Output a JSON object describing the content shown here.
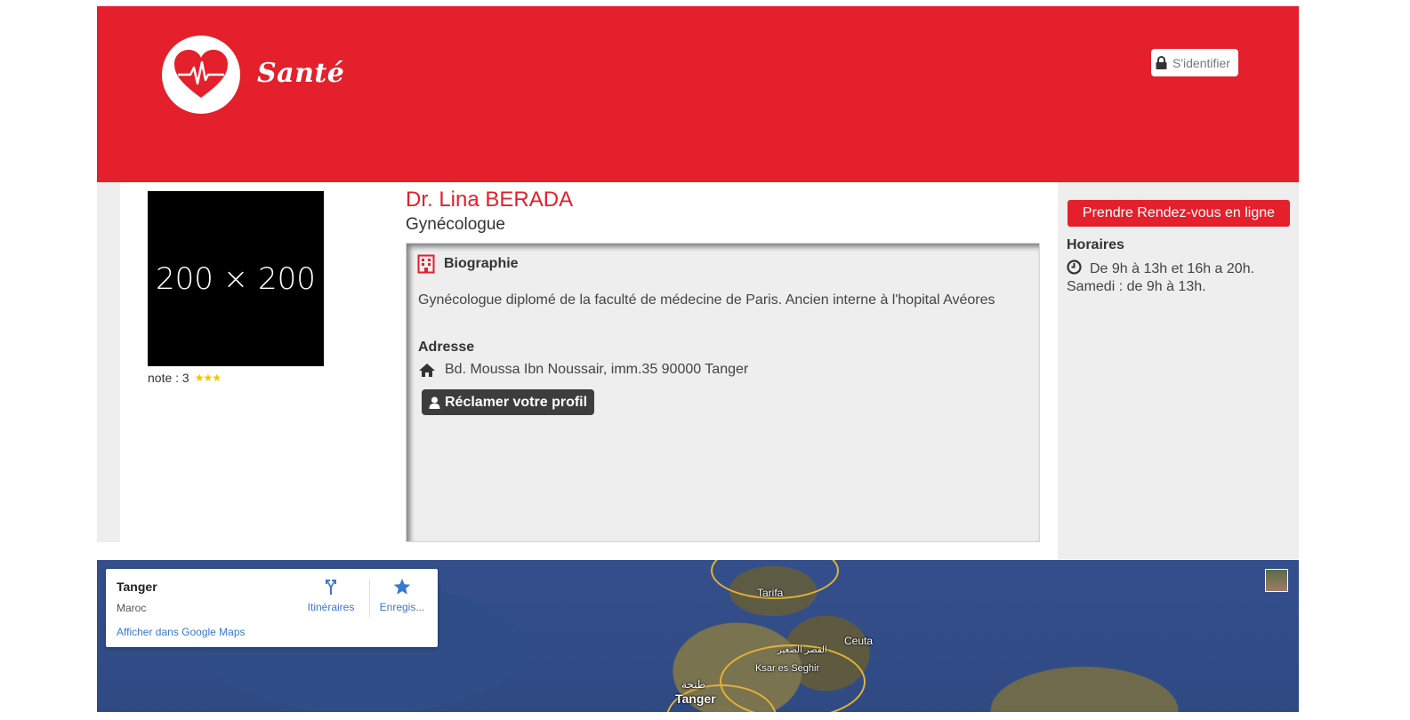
{
  "header": {
    "brand": "Santé",
    "login_label": "S'identifier",
    "background_color": "#e3202b",
    "logo_icon": "heart-pulse-icon"
  },
  "profile": {
    "photo_placeholder": "200 × 200",
    "note_label": "note : 3",
    "rating": 3,
    "rating_max": 3
  },
  "doctor": {
    "name": "Dr. Lina BERADA",
    "specialty": "Gynécologue"
  },
  "biography": {
    "heading": "Biographie",
    "text": "Gynécologue diplomé de la faculté de médecine de Paris. Ancien interne à l'hopital Avéores"
  },
  "address": {
    "heading": "Adresse",
    "text": "Bd. Moussa Ibn Noussair, imm.35 90000 Tanger"
  },
  "claim_button": "Réclamer votre profil",
  "appointment": {
    "button": "Prendre Rendez-vous en ligne",
    "hours_heading": "Horaires",
    "hours_line1": "De 9h à 13h et 16h a 20h.",
    "hours_line2": "Samedi : de 9h à 13h."
  },
  "map": {
    "place_title": "Tanger",
    "place_country": "Maroc",
    "view_link": "Afficher dans Google Maps",
    "directions_label": "Itinéraires",
    "save_label": "Enregis...",
    "labels": {
      "tarifa": "Tarifa",
      "ceuta": "Ceuta",
      "ksar_ar": "القصر الصغير",
      "ksar": "Ksar es Seghir",
      "tanger_ar": "طنجة",
      "tanger": "Tanger"
    }
  }
}
